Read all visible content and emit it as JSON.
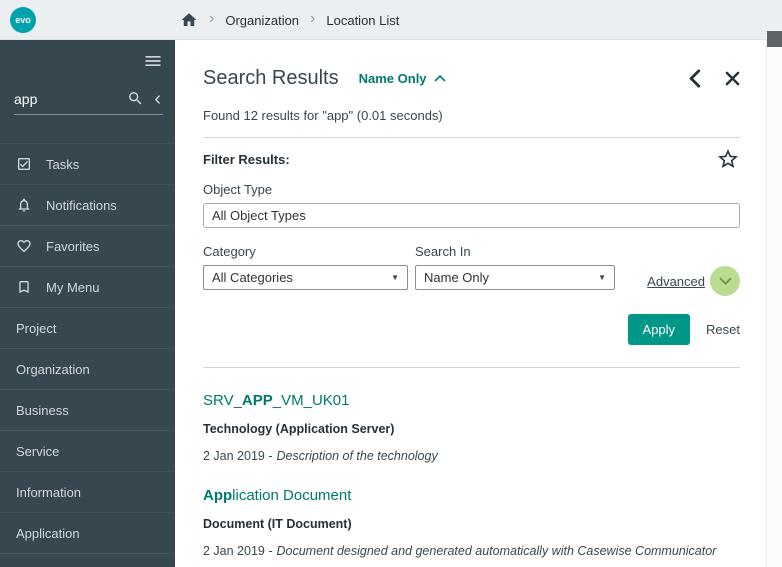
{
  "icons": {
    "chevron_right": "›",
    "chevron_left": "‹",
    "dropdown_arrow": "▼"
  },
  "colors": {
    "accent_teal": "#009688",
    "link_teal": "#00796b",
    "sidebar_bg": "#37474f",
    "header_bg": "#eceff1",
    "advanced_circle_green": "#b9db92"
  },
  "header": {
    "logo": "evo",
    "breadcrumb": [
      "Organization",
      "Location List"
    ]
  },
  "sidebar": {
    "search": {
      "value": "app"
    },
    "items": [
      {
        "label": "Tasks",
        "icon": "tasks-icon"
      },
      {
        "label": "Notifications",
        "icon": "bell-icon"
      },
      {
        "label": "Favorites",
        "icon": "heart-icon"
      },
      {
        "label": "My Menu",
        "icon": "bookmark-icon"
      },
      {
        "label": "Project"
      },
      {
        "label": "Organization"
      },
      {
        "label": "Business"
      },
      {
        "label": "Service"
      },
      {
        "label": "Information"
      },
      {
        "label": "Application"
      }
    ]
  },
  "main": {
    "title": "Search Results",
    "search_mode": "Name Only",
    "summary": "Found 12 results for \"app\" (0.01 seconds)",
    "filter": {
      "heading": "Filter Results:",
      "object_type_label": "Object Type",
      "object_type_value": "All Object Types",
      "category_label": "Category",
      "category_value": "All Categories",
      "search_in_label": "Search In",
      "search_in_value": "Name Only",
      "advanced_label": "Advanced",
      "apply_label": "Apply",
      "reset_label": "Reset"
    },
    "results": [
      {
        "title_prefix": "SRV_",
        "title_bold": "APP",
        "title_suffix": "_VM_UK01",
        "subtitle": "Technology (Application Server)",
        "date": "2 Jan 2019 -",
        "description": "Description of the technology"
      },
      {
        "title_prefix": "",
        "title_bold": "App",
        "title_suffix": "lication Document",
        "subtitle": "Document (IT Document)",
        "date": "2 Jan 2019 -",
        "description": "Document designed and generated automatically with Casewise Communicator"
      }
    ]
  }
}
